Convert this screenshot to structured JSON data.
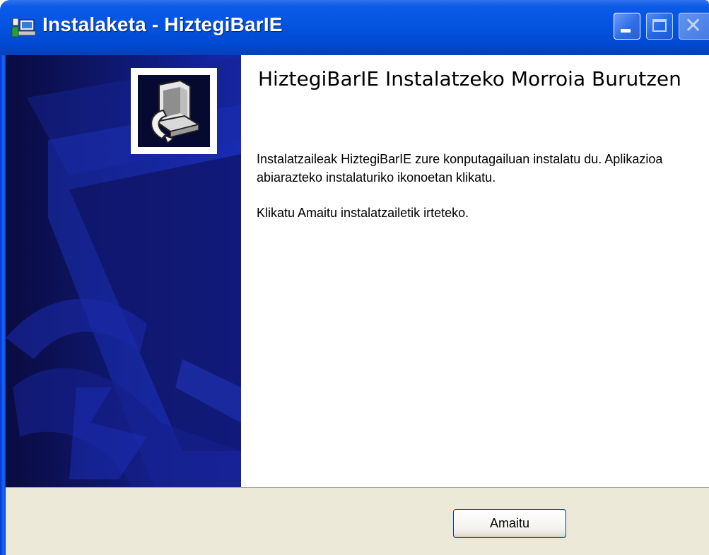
{
  "window": {
    "title": "Instalaketa - HiztegiBarIE",
    "controls": {
      "minimize": "minimize",
      "maximize": "maximize",
      "close": "close"
    }
  },
  "sidebar": {
    "logo_icon": "computer-install-icon",
    "colors": {
      "background": "#0b0e4f",
      "accent": "#1a2eb8"
    }
  },
  "content": {
    "heading": "HiztegiBarIE Instalatzeko Morroia Burutzen",
    "paragraph1": "Instalatzaileak HiztegiBarIE zure konputagailuan instalatu du. Aplikazioa abiarazteko instalaturiko ikonoetan klikatu.",
    "paragraph2": "Klikatu Amaitu instalatzailetik irteteko."
  },
  "footer": {
    "finish_label": "Amaitu"
  },
  "colors": {
    "titlebar": "#0454e0",
    "footer": "#ece9d8"
  }
}
